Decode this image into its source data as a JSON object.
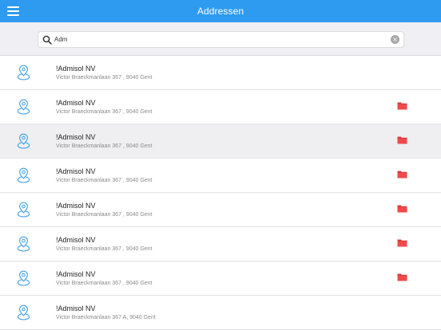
{
  "header": {
    "title": "Addressen"
  },
  "search": {
    "value": "Adm",
    "clear_glyph": "×"
  },
  "colors": {
    "navbar": "#2e9bf0",
    "pin": "#3a9ee6",
    "folder": "#ef4a4a"
  },
  "icons": {
    "menu": "menu-icon",
    "search": "search-icon",
    "clear": "clear-icon",
    "pin": "map-pin-icon",
    "folder": "folder-icon"
  },
  "addresses": [
    {
      "name": "!Admisol NV",
      "address": "Victor Braeckmanlaan 367 , 9040 Gent",
      "has_folder": false,
      "selected": false
    },
    {
      "name": "!Admisol NV",
      "address": "Victor Braeckmanlaan 367 , 9040 Gent",
      "has_folder": true,
      "selected": false
    },
    {
      "name": "!Admisol NV",
      "address": "Victor Braeckmanlaan 367 , 9040 Gent",
      "has_folder": true,
      "selected": true
    },
    {
      "name": "!Admisol NV",
      "address": "Victor Braeckmanlaan 367 , 9040 Gent",
      "has_folder": true,
      "selected": false
    },
    {
      "name": "!Admisol NV",
      "address": "Victor Braeckmanlaan 367 , 9040 Gent",
      "has_folder": true,
      "selected": false
    },
    {
      "name": "!Admisol NV",
      "address": "Victor Braeckmanlaan 367 , 9040 Gent",
      "has_folder": true,
      "selected": false
    },
    {
      "name": "!Admisol NV",
      "address": "Victor Braeckmanlaan 367 , 9040 Gent",
      "has_folder": true,
      "selected": false
    },
    {
      "name": "!Admisol NV",
      "address": "Victor Braeckmanlaan 367 A, 9040 Gent",
      "has_folder": false,
      "selected": false
    }
  ]
}
